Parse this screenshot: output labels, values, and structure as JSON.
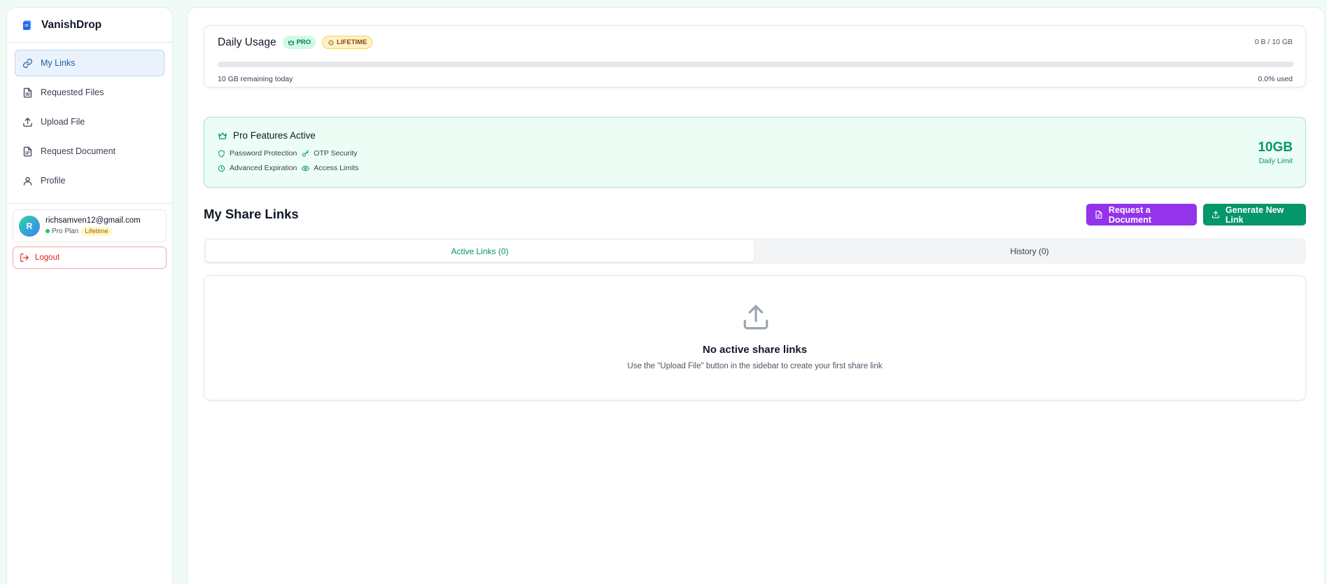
{
  "brand": {
    "name": "VanishDrop",
    "icon": "document-icon"
  },
  "sidebar": {
    "items": [
      {
        "label": "My Links",
        "icon": "link-icon",
        "active": true
      },
      {
        "label": "Requested Files",
        "icon": "file-icon"
      },
      {
        "label": "Upload File",
        "icon": "upload-icon"
      },
      {
        "label": "Request Document",
        "icon": "file-text-icon"
      },
      {
        "label": "Profile",
        "icon": "user-icon"
      }
    ]
  },
  "user": {
    "initial": "R",
    "email": "richsamven12@gmail.com",
    "plan": "Pro Plan",
    "plan_badge": "Lifetime"
  },
  "logout_label": "Logout",
  "usage": {
    "title": "Daily Usage",
    "badge_pro": "PRO",
    "badge_lifetime": "LIFETIME",
    "amount": "0 B / 10 GB",
    "remaining": "10 GB remaining today",
    "percent_used": "0.0% used",
    "progress_fraction": 0.0
  },
  "features": {
    "title": "Pro Features Active",
    "items": [
      "Password Protection",
      "OTP Security",
      "Advanced Expiration",
      "Access Limits"
    ],
    "limit_value": "10GB",
    "limit_label": "Daily Limit"
  },
  "links_section": {
    "title": "My Share Links",
    "request_button": "Request a Document",
    "generate_button": "Generate New Link",
    "tabs": [
      {
        "label": "Active Links (0)",
        "active": true
      },
      {
        "label": "History (0)"
      }
    ],
    "empty_title": "No active share links",
    "empty_subtitle": "Use the \"Upload File\" button in the sidebar to create your first share link"
  },
  "colors": {
    "accent_green": "#059669",
    "accent_purple": "#9333ea",
    "active_nav_blue": "#1d5fa8",
    "logout_red": "#dc2626"
  }
}
